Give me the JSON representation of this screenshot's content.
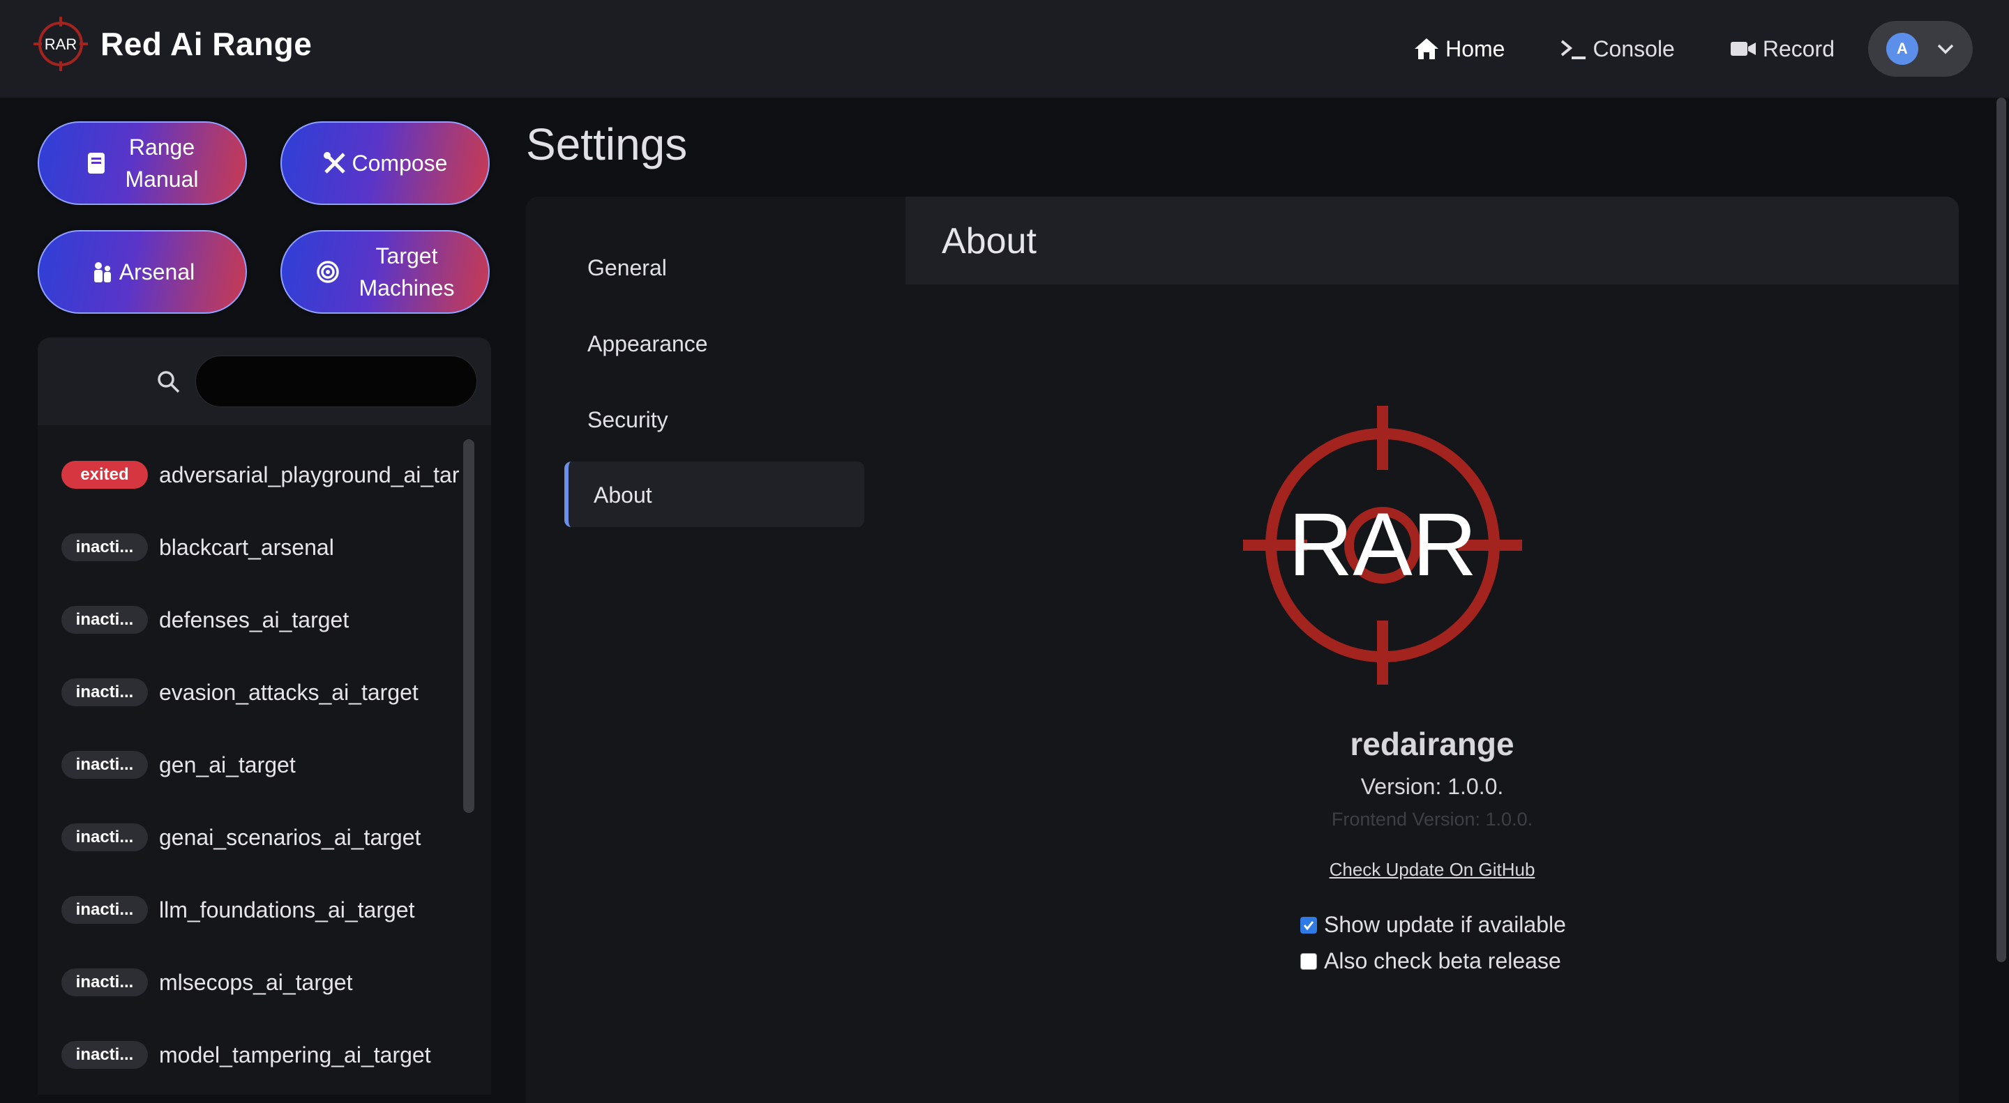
{
  "app": {
    "title": "Red Ai Range",
    "logo_text": "RAR"
  },
  "nav": {
    "home": "Home",
    "console": "Console",
    "record": "Record",
    "avatar_initial": "A"
  },
  "sidebar": {
    "buttons": {
      "range_manual_1": "Range",
      "range_manual_2": "Manual",
      "compose": "Compose",
      "arsenal": "Arsenal",
      "target_1": "Target",
      "target_2": "Machines"
    },
    "search": {
      "value": ""
    },
    "items": [
      {
        "status": "exited",
        "label": "adversarial_playground_ai_tar"
      },
      {
        "status": "inacti...",
        "label": "blackcart_arsenal"
      },
      {
        "status": "inacti...",
        "label": "defenses_ai_target"
      },
      {
        "status": "inacti...",
        "label": "evasion_attacks_ai_target"
      },
      {
        "status": "inacti...",
        "label": "gen_ai_target"
      },
      {
        "status": "inacti...",
        "label": "genai_scenarios_ai_target"
      },
      {
        "status": "inacti...",
        "label": "llm_foundations_ai_target"
      },
      {
        "status": "inacti...",
        "label": "mlsecops_ai_target"
      },
      {
        "status": "inacti...",
        "label": "model_tampering_ai_target"
      }
    ]
  },
  "settings": {
    "title": "Settings",
    "nav": [
      "General",
      "Appearance",
      "Security",
      "About"
    ],
    "active": "About",
    "about": {
      "header": "About",
      "logo_text": "RAR",
      "app_name": "redairange",
      "version": "Version: 1.0.0.",
      "frontend_version": "Frontend Version: 1.0.0.",
      "update_link": "Check Update On GitHub",
      "show_update_label": "Show update if available",
      "show_update_checked": true,
      "beta_label": "Also check beta release",
      "beta_checked": false
    }
  },
  "colors": {
    "accent": "#6d8fe8",
    "danger": "#d6363f",
    "logo_red": "#a3231f",
    "checkbox_blue": "#2f7ae5"
  }
}
